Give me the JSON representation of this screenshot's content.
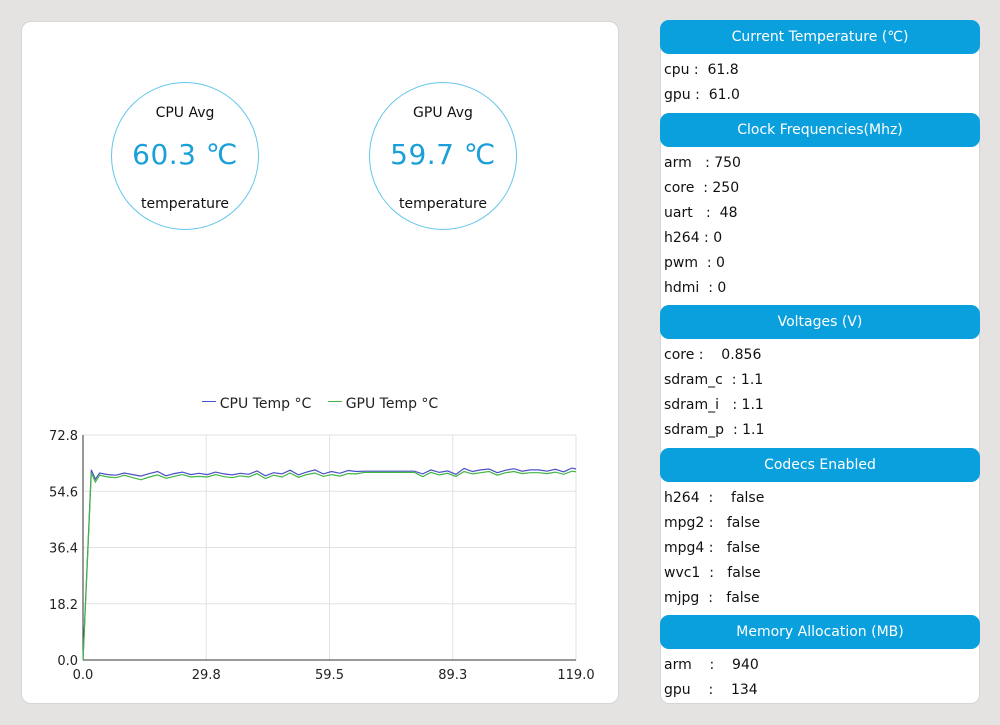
{
  "gauges": [
    {
      "title": "CPU Avg",
      "value": "60.3 ℃",
      "subtitle": "temperature"
    },
    {
      "title": "GPU Avg",
      "value": "59.7 ℃",
      "subtitle": "temperature"
    }
  ],
  "chart_data": {
    "type": "line",
    "series": [
      {
        "name": "CPU Temp °C",
        "color": "#4a50c8",
        "points": [
          [
            0,
            0
          ],
          [
            2,
            61.5
          ],
          [
            3,
            58.5
          ],
          [
            4,
            60.5
          ],
          [
            6,
            60
          ],
          [
            8,
            59.8
          ],
          [
            10,
            60.5
          ],
          [
            12,
            60
          ],
          [
            14,
            59.5
          ],
          [
            16,
            60.3
          ],
          [
            18,
            61
          ],
          [
            20,
            59.6
          ],
          [
            22,
            60.3
          ],
          [
            24,
            60.8
          ],
          [
            26,
            60
          ],
          [
            28,
            60.4
          ],
          [
            30,
            60
          ],
          [
            32,
            60.8
          ],
          [
            34,
            60.2
          ],
          [
            36,
            59.9
          ],
          [
            38,
            60.4
          ],
          [
            40,
            60.1
          ],
          [
            42,
            61.2
          ],
          [
            44,
            59.6
          ],
          [
            46,
            60.6
          ],
          [
            48,
            60.2
          ],
          [
            50,
            61.4
          ],
          [
            52,
            59.9
          ],
          [
            54,
            60.8
          ],
          [
            56,
            61.5
          ],
          [
            58,
            60.2
          ],
          [
            60,
            61
          ],
          [
            62,
            60.4
          ],
          [
            64,
            61.3
          ],
          [
            66,
            61
          ],
          [
            68,
            61.1
          ],
          [
            70,
            61.1
          ],
          [
            72,
            61.1
          ],
          [
            74,
            61.1
          ],
          [
            76,
            61.1
          ],
          [
            78,
            61.1
          ],
          [
            80,
            61.1
          ],
          [
            82,
            60.2
          ],
          [
            84,
            61.5
          ],
          [
            86,
            60.7
          ],
          [
            88,
            61.2
          ],
          [
            90,
            60.1
          ],
          [
            92,
            62
          ],
          [
            94,
            61
          ],
          [
            96,
            61.5
          ],
          [
            98,
            61.8
          ],
          [
            100,
            60.6
          ],
          [
            102,
            61.4
          ],
          [
            104,
            61.9
          ],
          [
            106,
            61.1
          ],
          [
            108,
            61.5
          ],
          [
            110,
            61.5
          ],
          [
            112,
            61.1
          ],
          [
            114,
            61.7
          ],
          [
            116,
            60.9
          ],
          [
            118,
            62.1
          ],
          [
            119,
            61.8
          ]
        ]
      },
      {
        "name": "GPU Temp °C",
        "color": "#41b644",
        "points": [
          [
            0,
            0
          ],
          [
            2,
            60.6
          ],
          [
            3,
            57.6
          ],
          [
            4,
            59.8
          ],
          [
            6,
            59.2
          ],
          [
            8,
            59
          ],
          [
            10,
            59.8
          ],
          [
            12,
            59
          ],
          [
            14,
            58.3
          ],
          [
            16,
            59.2
          ],
          [
            18,
            59.9
          ],
          [
            20,
            58.8
          ],
          [
            22,
            59.4
          ],
          [
            24,
            60
          ],
          [
            26,
            59.2
          ],
          [
            28,
            59.4
          ],
          [
            30,
            59.2
          ],
          [
            32,
            60
          ],
          [
            34,
            59.3
          ],
          [
            36,
            59
          ],
          [
            38,
            59.6
          ],
          [
            40,
            59.2
          ],
          [
            42,
            60.3
          ],
          [
            44,
            58.7
          ],
          [
            46,
            59.8
          ],
          [
            48,
            59.2
          ],
          [
            50,
            60.5
          ],
          [
            52,
            59.1
          ],
          [
            54,
            60
          ],
          [
            56,
            60.5
          ],
          [
            58,
            59.4
          ],
          [
            60,
            60
          ],
          [
            62,
            59.5
          ],
          [
            64,
            60.3
          ],
          [
            66,
            60.2
          ],
          [
            68,
            60.7
          ],
          [
            70,
            60.7
          ],
          [
            72,
            60.7
          ],
          [
            74,
            60.7
          ],
          [
            76,
            60.7
          ],
          [
            78,
            60.7
          ],
          [
            80,
            60.7
          ],
          [
            82,
            59.3
          ],
          [
            84,
            60.7
          ],
          [
            86,
            59.9
          ],
          [
            88,
            60.4
          ],
          [
            90,
            59.4
          ],
          [
            92,
            61
          ],
          [
            94,
            60.2
          ],
          [
            96,
            60.6
          ],
          [
            98,
            61
          ],
          [
            100,
            59.8
          ],
          [
            102,
            60.6
          ],
          [
            104,
            61
          ],
          [
            106,
            60.3
          ],
          [
            108,
            60.6
          ],
          [
            110,
            60.6
          ],
          [
            112,
            60.3
          ],
          [
            114,
            60.8
          ],
          [
            116,
            60.1
          ],
          [
            118,
            61.1
          ],
          [
            119,
            60.9
          ]
        ]
      }
    ],
    "xlim": [
      0,
      119
    ],
    "ylim": [
      0,
      72.8
    ],
    "xticks": [
      "0.0",
      "29.8",
      "59.5",
      "89.3",
      "119.0"
    ],
    "yticks": [
      "0.0",
      "18.2",
      "36.4",
      "54.6",
      "72.8"
    ],
    "grid": true,
    "legend": "top-center"
  },
  "panel": {
    "sections": [
      {
        "title": "Current Temperature (℃)",
        "rows": [
          "cpu :  61.8",
          "gpu :  61.0"
        ]
      },
      {
        "title": "Clock Frequencies(Mhz)",
        "rows": [
          "arm   : 750",
          "core  : 250",
          "uart   :  48",
          "h264 : 0",
          "pwm  : 0",
          "hdmi  : 0"
        ]
      },
      {
        "title": "Voltages (V)",
        "rows": [
          "core :    0.856",
          "sdram_c  : 1.1",
          "sdram_i   : 1.1",
          "sdram_p  : 1.1"
        ]
      },
      {
        "title": "Codecs Enabled",
        "rows": [
          "h264  :    false",
          "mpg2 :   false",
          "mpg4 :   false",
          "wvc1  :   false",
          "mjpg  :   false"
        ]
      },
      {
        "title": "Memory Allocation (MB)",
        "rows": [
          "arm    :    940",
          "gpu    :    134"
        ]
      }
    ]
  }
}
